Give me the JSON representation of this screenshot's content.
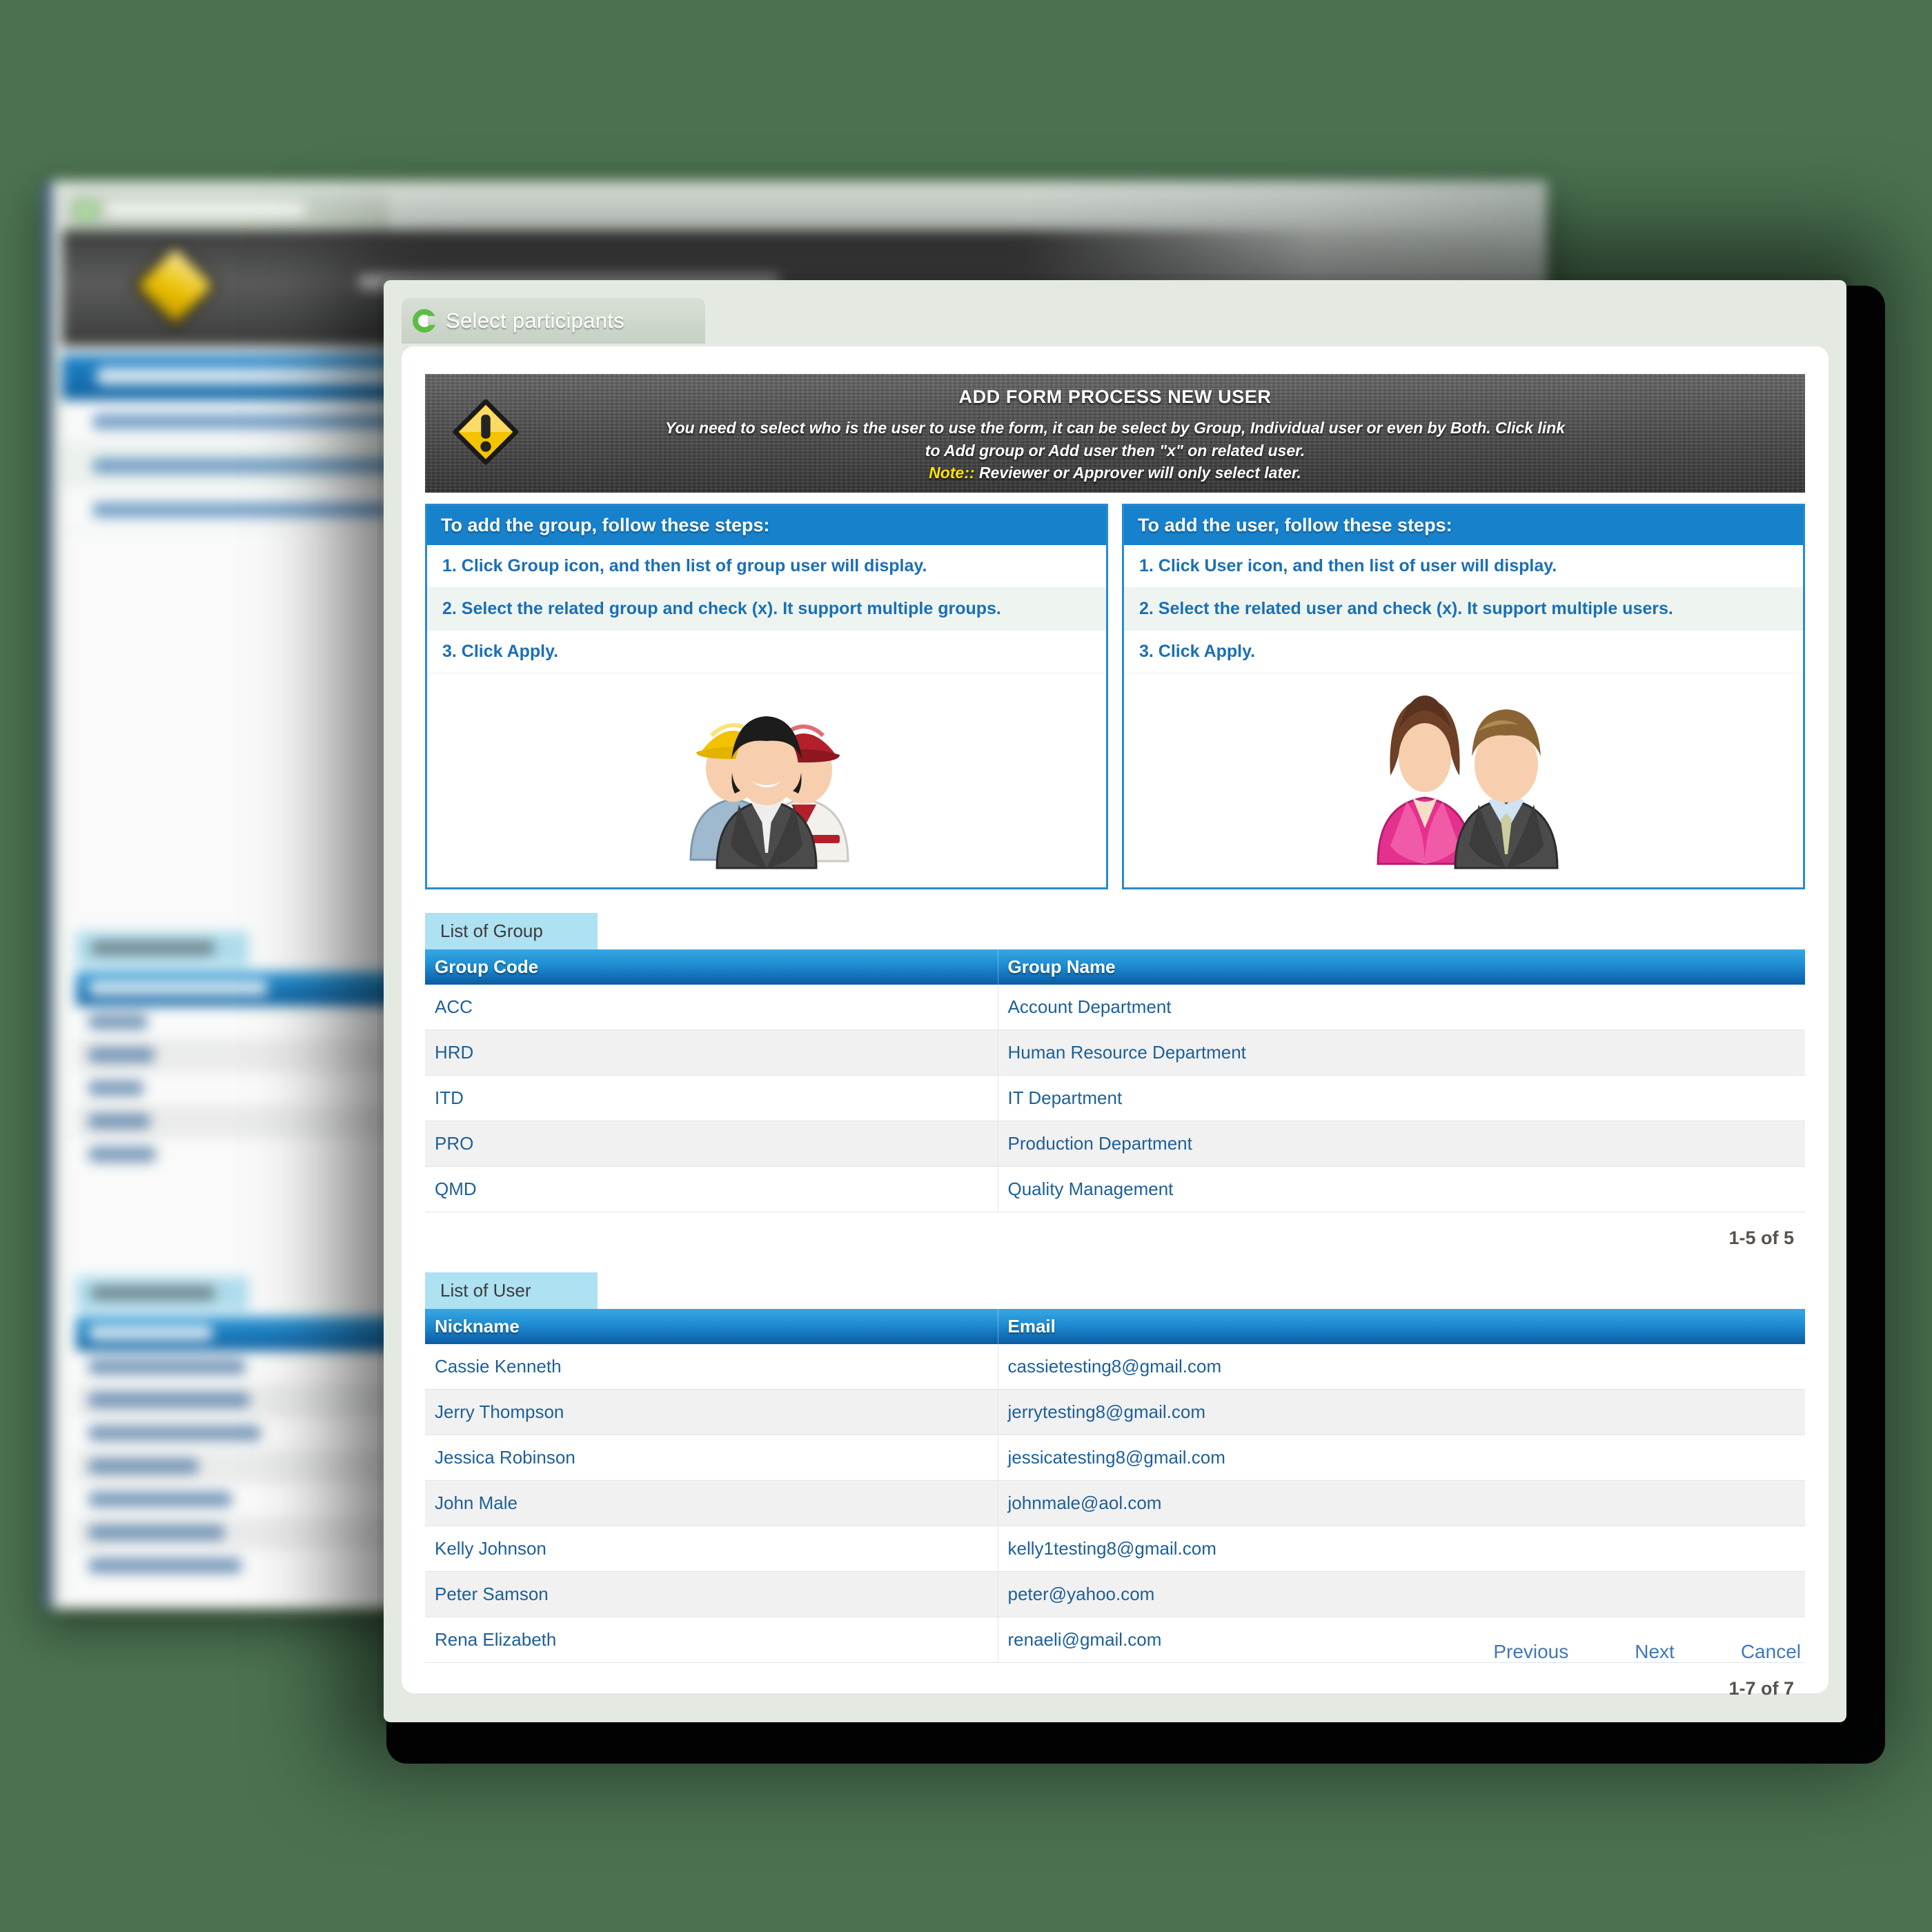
{
  "background_window": {
    "description": "blurred duplicate of the same Select participants screen behind the dialog"
  },
  "window": {
    "tab": {
      "label": "Select participants",
      "icon": "refresh-circle-icon"
    }
  },
  "banner": {
    "icon": "warning-diamond-icon",
    "title": "ADD FORM PROCESS NEW USER",
    "line1": "You need to select who is the user to use the form, it can be select by Group, Individual user or even by Both. Click link",
    "line2": "to Add group or Add user then \"x\" on related user.",
    "note_label": "Note::",
    "note_text": "Reviewer or Approver will only select later."
  },
  "instructions": {
    "group": {
      "heading": "To add the group, follow these steps:",
      "steps": [
        "1. Click Group icon, and then list of group user will display.",
        "2. Select the related group and check (x). It support multiple groups.",
        "3. Click Apply."
      ],
      "image_icon": "group-workers-icon"
    },
    "user": {
      "heading": "To add the user, follow these steps:",
      "steps": [
        "1. Click User icon, and then list of user will display.",
        "2. Select the related user and check (x). It support multiple users.",
        "3. Click Apply."
      ],
      "image_icon": "two-users-icon"
    }
  },
  "group_table": {
    "section_label": "List of Group",
    "columns": [
      "Group Code",
      "Group Name"
    ],
    "rows": [
      [
        "ACC",
        "Account Department"
      ],
      [
        "HRD",
        "Human Resource Department"
      ],
      [
        "ITD",
        "IT Department"
      ],
      [
        "PRO",
        "Production Department"
      ],
      [
        "QMD",
        "Quality Management"
      ]
    ],
    "pager": "1-5 of 5"
  },
  "user_table": {
    "section_label": "List of User",
    "columns": [
      "Nickname",
      "Email"
    ],
    "rows": [
      [
        "Cassie Kenneth",
        "cassietesting8@gmail.com"
      ],
      [
        "Jerry Thompson",
        "jerrytesting8@gmail.com"
      ],
      [
        "Jessica Robinson",
        "jessicatesting8@gmail.com"
      ],
      [
        "John Male",
        "johnmale@aol.com"
      ],
      [
        "Kelly Johnson",
        "kelly1testing8@gmail.com"
      ],
      [
        "Peter Samson",
        "peter@yahoo.com"
      ],
      [
        "Rena Elizabeth",
        "renaeli@gmail.com"
      ]
    ],
    "pager": "1-7 of 7"
  },
  "footer": {
    "previous": "Previous",
    "next": "Next",
    "cancel": "Cancel"
  },
  "colors": {
    "desktop_green": "#4a7150",
    "panel_frame": "#e4eae2",
    "accent_blue": "#1781cb",
    "table_header_blue": "#1e8cd2",
    "section_tab_blue": "#aee1f2",
    "link_blue": "#3f76bd",
    "warn_yellow": "#ffe400",
    "tab_green": "#5cbd44"
  }
}
